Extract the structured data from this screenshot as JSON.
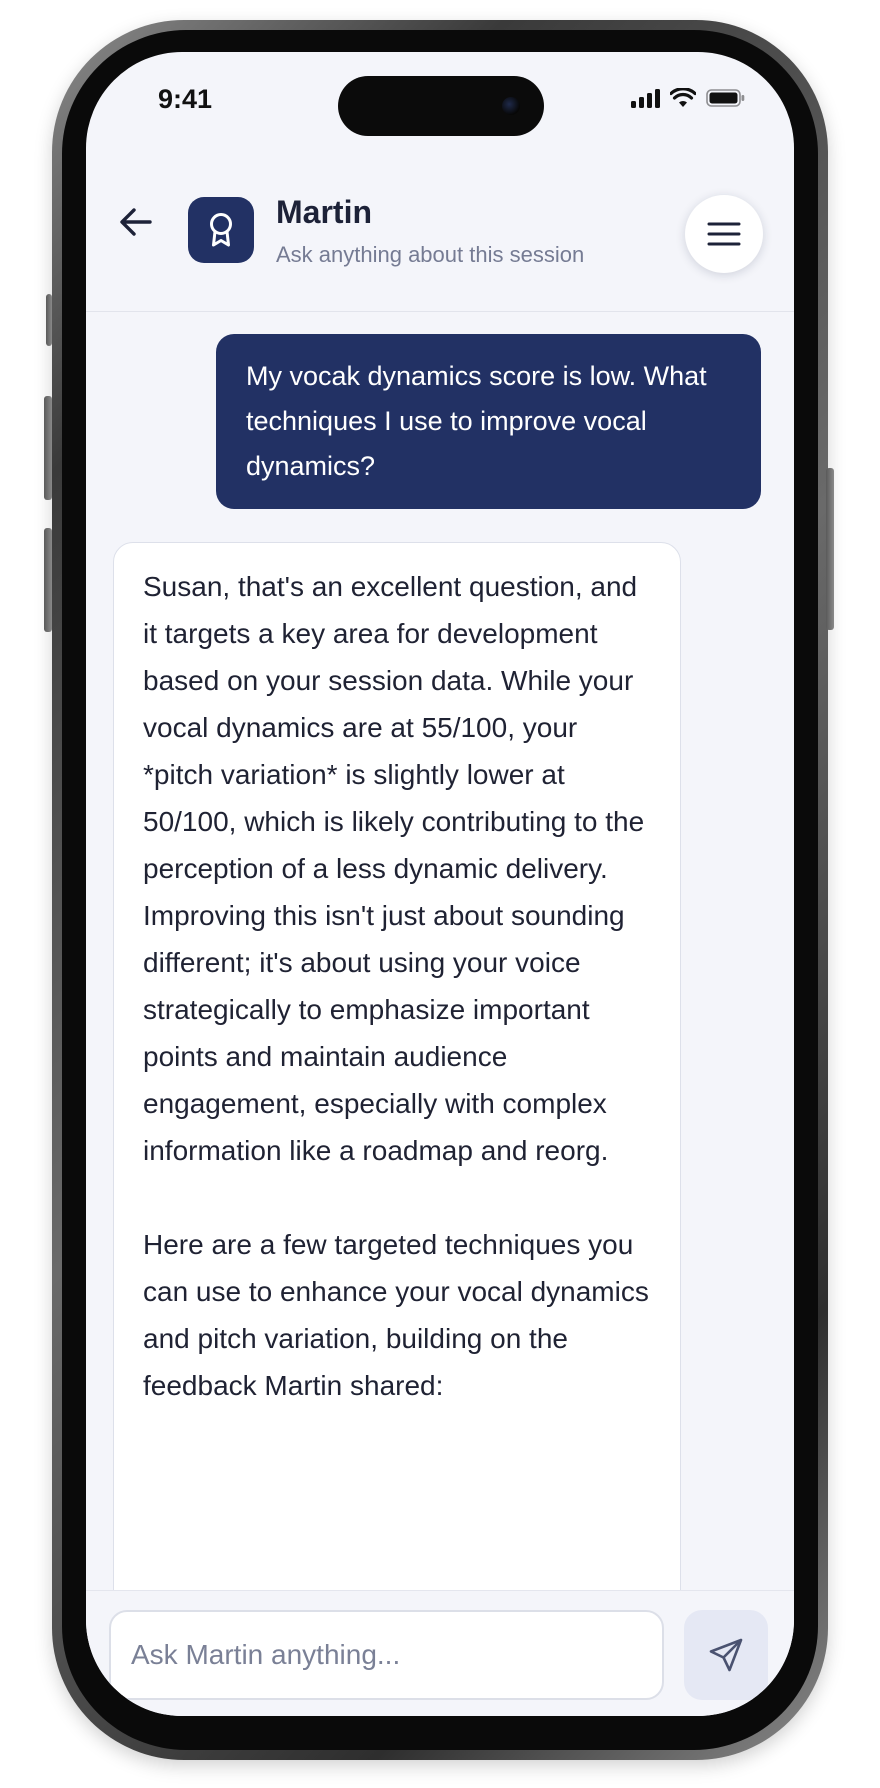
{
  "status_bar": {
    "time": "9:41"
  },
  "header": {
    "title": "Martin",
    "subtitle": "Ask anything about this session",
    "avatar_icon": "award-ribbon-icon",
    "back_icon": "arrow-left-icon",
    "menu_icon": "hamburger-menu-icon"
  },
  "messages": [
    {
      "role": "user",
      "text": "My vocak dynamics score is low. What techniques I use to improve vocal dynamics?"
    },
    {
      "role": "assistant",
      "paragraphs": [
        "Susan, that's an excellent question, and it targets a key area for development based on your session data. While your vocal dynamics are at 55/100, your *pitch variation* is slightly lower at 50/100, which is likely contributing to the perception of a less dynamic delivery. Improving this isn't just about sounding different; it's about using your voice strategically to emphasize important points and maintain audience engagement, especially with complex information like a roadmap and reorg.",
        "Here are a few targeted techniques you can use to enhance your vocal dynamics and pitch variation, building on the feedback Martin shared:"
      ]
    }
  ],
  "composer": {
    "placeholder": "Ask Martin anything...",
    "value": "",
    "send_icon": "send-icon"
  },
  "colors": {
    "accent": "#223164",
    "background": "#f4f5fa",
    "bubble_bot": "#ffffff",
    "send_button_bg": "#e5e8f4"
  }
}
